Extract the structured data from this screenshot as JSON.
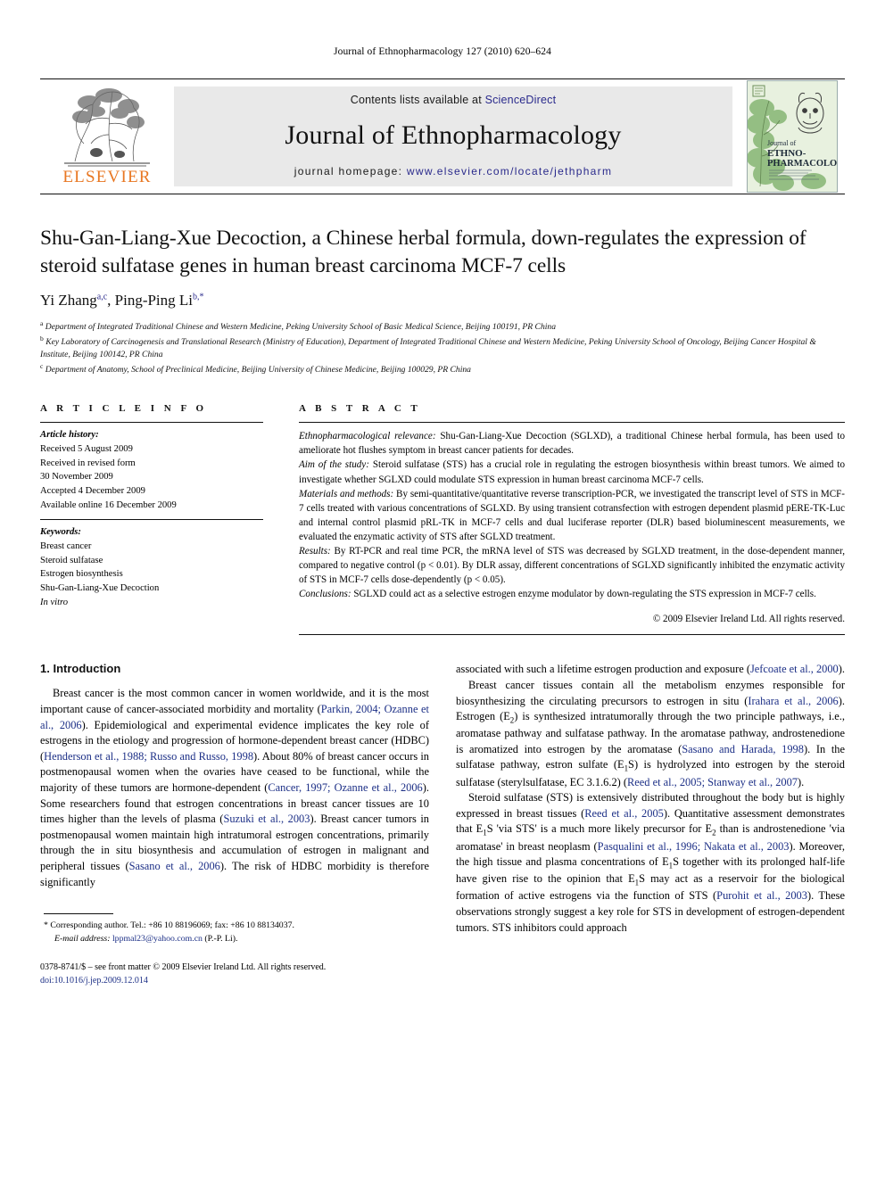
{
  "running_head": "Journal of Ethnopharmacology 127 (2010) 620–624",
  "masthead": {
    "contents_prefix": "Contents lists available at",
    "sciencedirect": "ScienceDirect",
    "journal_name": "Journal of Ethnopharmacology",
    "homepage_prefix": "journal homepage:",
    "homepage_url": "www.elsevier.com/locate/jethpharm",
    "publisher": "ELSEVIER",
    "cover_title_line1": "Journal of",
    "cover_title_line2": "ETHNO-",
    "cover_title_line3": "PHARMACOLOGY",
    "publisher_color": "#e87722",
    "link_color": "#2a2a8c"
  },
  "article": {
    "title": "Shu-Gan-Liang-Xue Decoction, a Chinese herbal formula, down-regulates the expression of steroid sulfatase genes in human breast carcinoma MCF-7 cells",
    "authors": [
      {
        "name": "Yi Zhang",
        "marks": "a,c"
      },
      {
        "name": "Ping-Ping Li",
        "marks": "b,*"
      }
    ],
    "affiliations": [
      {
        "mark": "a",
        "text": "Department of Integrated Traditional Chinese and Western Medicine, Peking University School of Basic Medical Science, Beijing 100191, PR China"
      },
      {
        "mark": "b",
        "text": "Key Laboratory of Carcinogenesis and Translational Research (Ministry of Education), Department of Integrated Traditional Chinese and Western Medicine, Peking University School of Oncology, Beijing Cancer Hospital & Institute, Beijing 100142, PR China"
      },
      {
        "mark": "c",
        "text": "Department of Anatomy, School of Preclinical Medicine, Beijing University of Chinese Medicine, Beijing 100029, PR China"
      }
    ]
  },
  "article_info": {
    "heading": "A R T I C L E   I N F O",
    "history_label": "Article history:",
    "history": [
      "Received 5 August 2009",
      "Received in revised form",
      "30 November 2009",
      "Accepted 4 December 2009",
      "Available online 16 December 2009"
    ],
    "keywords_label": "Keywords:",
    "keywords": [
      "Breast cancer",
      "Steroid sulfatase",
      "Estrogen biosynthesis",
      "Shu-Gan-Liang-Xue Decoction",
      "In vitro"
    ]
  },
  "abstract": {
    "heading": "A B S T R A C T",
    "sections": [
      {
        "lead": "Ethnopharmacological relevance:",
        "text": " Shu-Gan-Liang-Xue Decoction (SGLXD), a traditional Chinese herbal formula, has been used to ameliorate hot flushes symptom in breast cancer patients for decades."
      },
      {
        "lead": "Aim of the study:",
        "text": " Steroid sulfatase (STS) has a crucial role in regulating the estrogen biosynthesis within breast tumors. We aimed to investigate whether SGLXD could modulate STS expression in human breast carcinoma MCF-7 cells."
      },
      {
        "lead": "Materials and methods:",
        "text": " By semi-quantitative/quantitative reverse transcription-PCR, we investigated the transcript level of STS in MCF-7 cells treated with various concentrations of SGLXD. By using transient cotransfection with estrogen dependent plasmid pERE-TK-Luc and internal control plasmid pRL-TK in MCF-7 cells and dual luciferase reporter (DLR) based bioluminescent measurements, we evaluated the enzymatic activity of STS after SGLXD treatment."
      },
      {
        "lead": "Results:",
        "text": " By RT-PCR and real time PCR, the mRNA level of STS was decreased by SGLXD treatment, in the dose-dependent manner, compared to negative control (p < 0.01). By DLR assay, different concentrations of SGLXD significantly inhibited the enzymatic activity of STS in MCF-7 cells dose-dependently (p < 0.05)."
      },
      {
        "lead": "Conclusions:",
        "text": " SGLXD could act as a selective estrogen enzyme modulator by down-regulating the STS expression in MCF-7 cells."
      }
    ],
    "copyright": "© 2009 Elsevier Ireland Ltd. All rights reserved."
  },
  "body": {
    "section_heading": "1. Introduction",
    "left_paragraphs": [
      "Breast cancer is the most common cancer in women worldwide, and it is the most important cause of cancer-associated morbidity and mortality (@Parkin, 2004; Ozanne et al., 2006@). Epidemiological and experimental evidence implicates the key role of estrogens in the etiology and progression of hormone-dependent breast cancer (HDBC) (@Henderson et al., 1988; Russo and Russo, 1998@). About 80% of breast cancer occurs in postmenopausal women when the ovaries have ceased to be functional, while the majority of these tumors are hormone-dependent (@Cancer, 1997; Ozanne et al., 2006@). Some researchers found that estrogen concentrations in breast cancer tissues are 10 times higher than the levels of plasma (@Suzuki et al., 2003@). Breast cancer tumors in postmenopausal women maintain high intratumoral estrogen concentrations, primarily through the in situ biosynthesis and accumulation of estrogen in malignant and peripheral tissues (@Sasano et al., 2006@). The risk of HDBC morbidity is therefore significantly"
    ],
    "right_paragraphs": [
      "associated with such a lifetime estrogen production and exposure (@Jefcoate et al., 2000@).",
      "Breast cancer tissues contain all the metabolism enzymes responsible for biosynthesizing the circulating precursors to estrogen in situ (@Irahara et al., 2006@). Estrogen (E#2#) is synthesized intratumorally through the two principle pathways, i.e., aromatase pathway and sulfatase pathway. In the aromatase pathway, androstenedione is aromatized into estrogen by the aromatase (@Sasano and Harada, 1998@). In the sulfatase pathway, estron sulfate (E#1#S) is hydrolyzed into estrogen by the steroid sulfatase (sterylsulfatase, EC 3.1.6.2) (@Reed et al., 2005; Stanway et al., 2007@).",
      "Steroid sulfatase (STS) is extensively distributed throughout the body but is highly expressed in breast tissues (@Reed et al., 2005@). Quantitative assessment demonstrates that E#1#S 'via STS' is a much more likely precursor for E#2# than is androstenedione 'via aromatase' in breast neoplasm (@Pasqualini et al., 1996; Nakata et al., 2003@). Moreover, the high tissue and plasma concentrations of E#1#S together with its prolonged half-life have given rise to the opinion that E#1#S may act as a reservoir for the biological formation of active estrogens via the function of STS (@Purohit et al., 2003@). These observations strongly suggest a key role for STS in development of estrogen-dependent tumors. STS inhibitors could approach"
    ]
  },
  "footnote": {
    "corresponding": "* Corresponding author. Tel.: +86 10 88196069; fax: +86 10 88134037.",
    "email_label": "E-mail address:",
    "email": "lppmal23@yahoo.com.cn",
    "email_suffix": " (P.-P. Li)."
  },
  "imprint": {
    "line1": "0378-8741/$ – see front matter © 2009 Elsevier Ireland Ltd. All rights reserved.",
    "doi": "doi:10.1016/j.jep.2009.12.014"
  }
}
